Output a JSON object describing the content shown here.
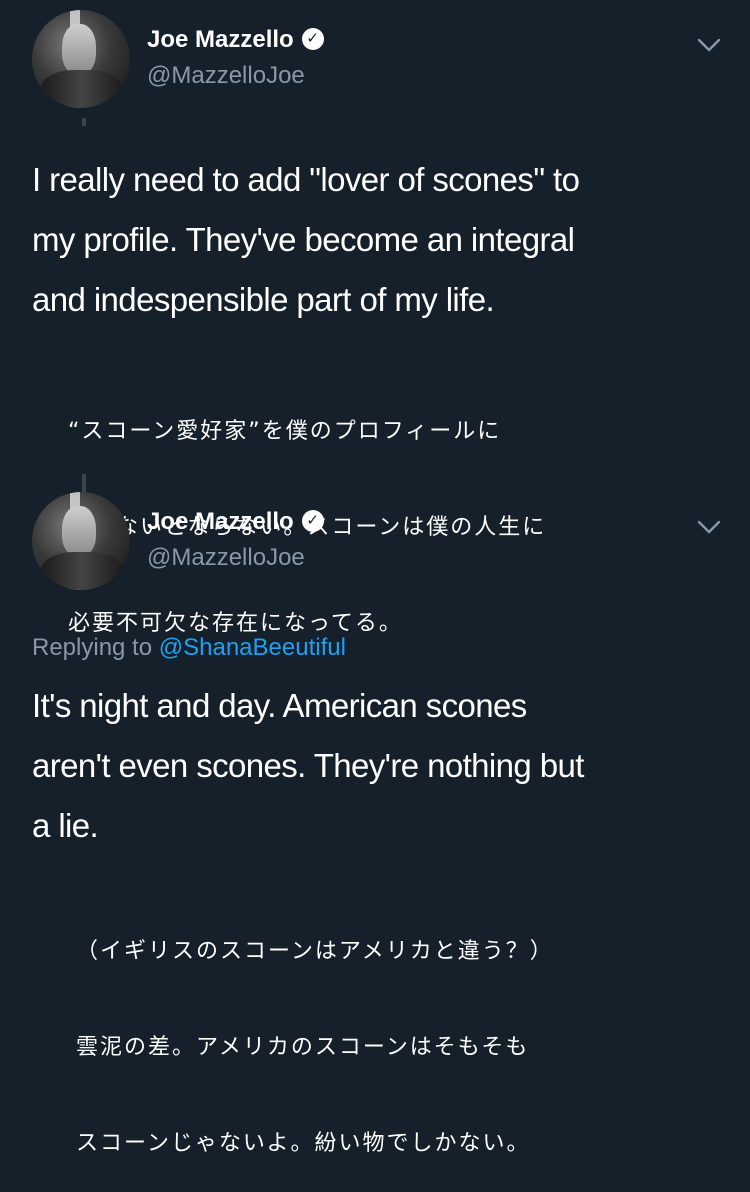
{
  "tweets": [
    {
      "author_name": "Joe Mazzello",
      "handle": "@MazzelloJoe",
      "text_lines": [
        "I really need to add \"lover of scones\" to",
        "my profile. They've become an integral",
        "and indespensible part of my life."
      ],
      "translation_lines": [
        "“スコーン愛好家”を僕のプロフィールに",
        "加えないとならない。スコーンは僕の人生に",
        "必要不可欠な存在になってる。"
      ]
    },
    {
      "author_name": "Joe Mazzello",
      "handle": "@MazzelloJoe",
      "replying_prefix": "Replying to",
      "replying_to": "@ShanaBeeutiful",
      "text_lines": [
        "It's night and day. American scones",
        "aren't even scones. They're nothing but",
        "a lie."
      ],
      "translation_lines": [
        "（イギリスのスコーンはアメリカと違う？）",
        "雲泥の差。アメリカのスコーンはそもそも",
        "スコーンじゃないよ。紛い物でしかない。"
      ]
    }
  ],
  "icons": {
    "verified": "verified-badge-icon",
    "caret": "chevron-down-icon"
  },
  "colors": {
    "background": "#15202b",
    "secondary_text": "#8899a6",
    "link": "#1da1f2"
  }
}
